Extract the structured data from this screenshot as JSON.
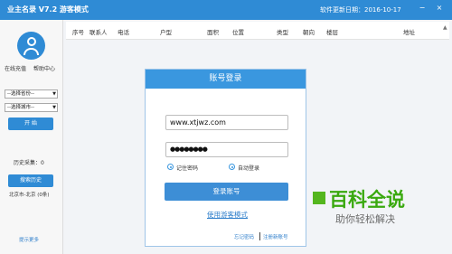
{
  "window": {
    "title": "业主名录 V7.2 游客模式",
    "update_date": "软件更新日期：2016-10-17"
  },
  "sidebar": {
    "online_service": "在线充值",
    "help_center": "帮助中心",
    "province_select": "--选择省份--",
    "city_select": "--选择城市--",
    "start_button": "开 始",
    "history_count": "历史采集：0",
    "search_history_button": "搜索历史",
    "history_item": "北京市-北京 (0条)",
    "more_tips": "提示更多"
  },
  "table": {
    "columns": [
      "序号",
      "联系人",
      "电话",
      "户型",
      "面积",
      "位置",
      "类型",
      "朝向",
      "楼层",
      "地址"
    ]
  },
  "dialog": {
    "title": "账号登录",
    "account_value": "www.xtjwz.com",
    "password_value": "●●●●●●●●",
    "remember_label": "记住密码",
    "auto_login_label": "自动登录",
    "login_button": "登录账号",
    "guest_link": "使用游客模式",
    "forgot_link": "忘记密码",
    "register_link": "注册新账号"
  },
  "watermark": {
    "title": "百科全说",
    "subtitle": "助你轻松解决"
  },
  "colors": {
    "title_bar": "#2f8bd5",
    "accent": "#3a97df",
    "watermark": "#3aa90f"
  }
}
